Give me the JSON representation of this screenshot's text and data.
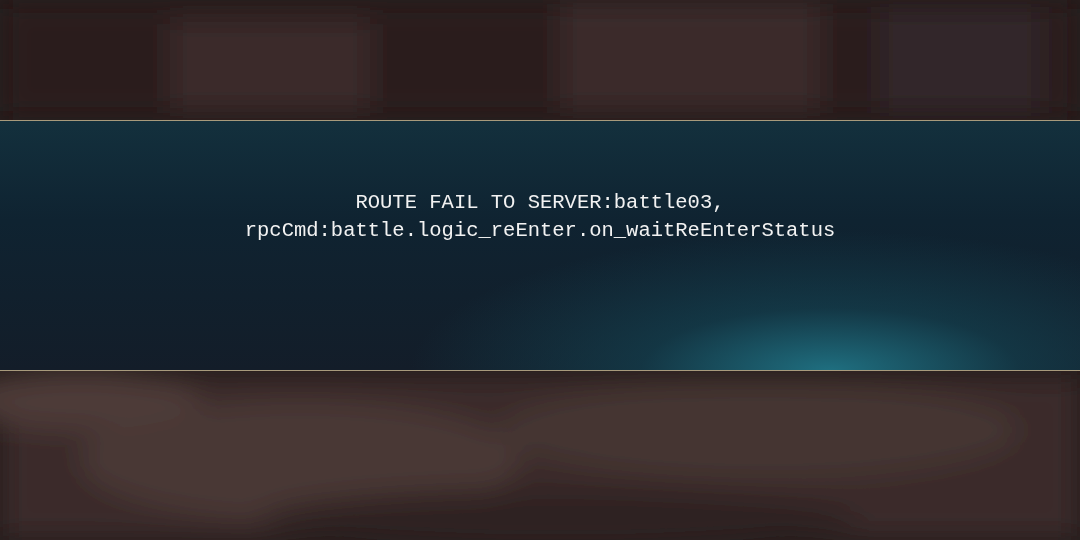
{
  "error_banner": {
    "message_lines": [
      "ROUTE FAIL TO SERVER:battle03,",
      "rpcCmd:battle.logic_reEnter.on_waitReEnterStatus"
    ]
  }
}
